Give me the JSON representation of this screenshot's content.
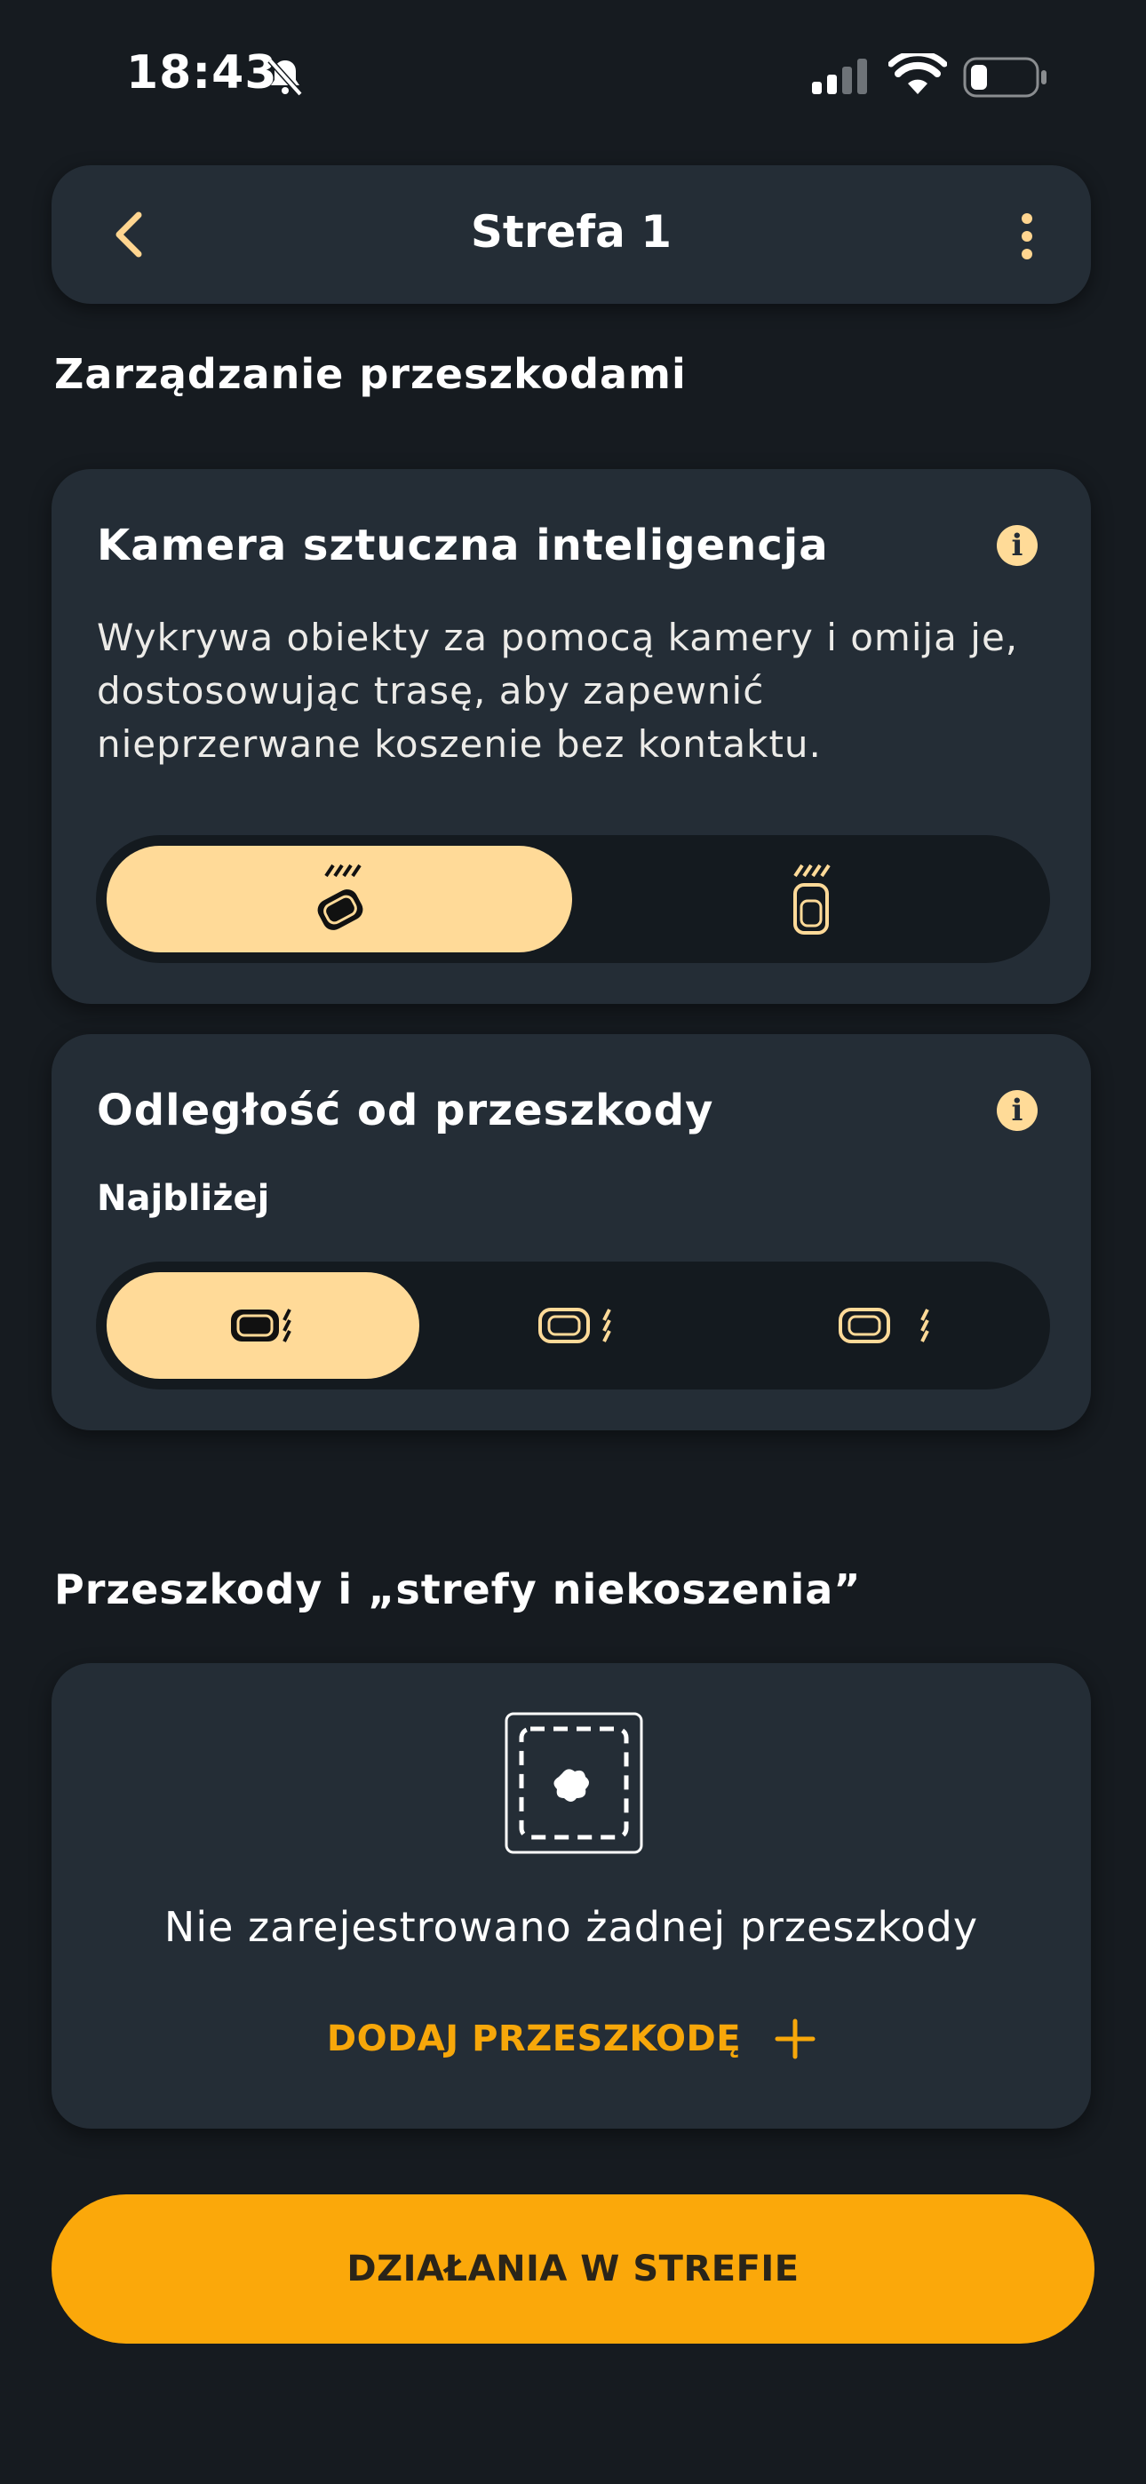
{
  "status_bar": {
    "time": "18:43"
  },
  "header": {
    "title": "Strefa 1"
  },
  "obstacle_management": {
    "section_title": "Zarządzanie przeszkodami",
    "camera_card": {
      "title": "Kamera sztuczna inteligencja",
      "description_lines": [
        "Wykrywa obiekty za pomocą kamery i omija je,",
        "dostosowując trasę, aby zapewnić",
        "nieprzerwane koszenie bez kontaktu."
      ],
      "selected_option_index": 0
    },
    "distance_card": {
      "title": "Odległość od przeszkody",
      "current_value": "Najbliżej",
      "selected_option_index": 0
    }
  },
  "obstacles": {
    "section_title": "Przeszkody i „strefy niekoszenia”",
    "empty_message": "Nie zarejestrowano żadnej przeszkody",
    "add_label": "DODAJ PRZESZKODĘ"
  },
  "primary_action": {
    "label": "DZIAŁANIA W STREFIE"
  },
  "colors": {
    "background": "#161b20",
    "card": "#242d36",
    "accent": "#fba80a",
    "accent_light": "#ffda98"
  }
}
